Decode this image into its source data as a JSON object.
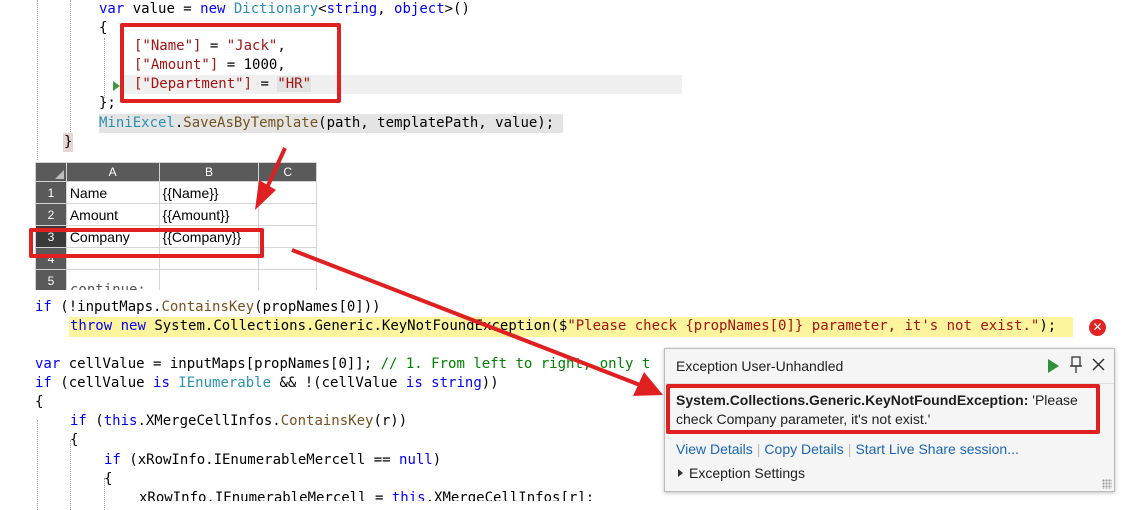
{
  "code_top": {
    "line1": {
      "kw1": "var",
      "txt1": " value = ",
      "kw2": "new",
      "ty": " Dictionary",
      "txt2": "<",
      "kw3": "string",
      "txt3": ", ",
      "kw4": "object",
      "txt4": ">()"
    },
    "brace_open": "{",
    "row_name": {
      "k": "[\"Name\"]",
      "eq": " = ",
      "v": "\"Jack\"",
      "end": ","
    },
    "row_amount": {
      "k": "[\"Amount\"]",
      "eq": " = 1000,"
    },
    "row_dept": {
      "k": "[\"Department\"]",
      "eq": " = ",
      "v": "\"HR\""
    },
    "brace_close": "};",
    "save": {
      "cls": "MiniExcel",
      "dot": ".",
      "m": "SaveAsByTemplate",
      "args": "(path, templatePath, value);"
    },
    "end_brace": "}"
  },
  "sheet": {
    "columns": [
      "A",
      "B",
      "C"
    ],
    "rows": [
      {
        "num": "1",
        "a": "Name",
        "b": "{{Name}}"
      },
      {
        "num": "2",
        "a": "Amount",
        "b": "{{Amount}}"
      },
      {
        "num": "3",
        "a": "Company",
        "b": "{{Company}}"
      },
      {
        "num": "4",
        "a": "",
        "b": ""
      },
      {
        "num": "5",
        "a": "",
        "b": ""
      }
    ]
  },
  "code_bottom": {
    "partial_top": "continue;",
    "if1": {
      "kw": "if",
      "a": " (!inputMaps.",
      "m": "ContainsKey",
      "b": "(propNames[0]))"
    },
    "throw": {
      "kw1": "throw",
      "sp": " ",
      "kw2": "new",
      "t": " System.Collections.Generic.KeyNotFoundException($",
      "s": "\"Please check {propNames[0]} parameter, it's not exist.\"",
      "e": ");"
    },
    "var_line": {
      "kw": "var",
      "a": " cellValue = inputMaps[propNames[0]]; ",
      "c": "// 1. From left to right, only t"
    },
    "if2": {
      "kw": "if",
      "a": " (cellValue ",
      "kw2": "is",
      "t": " IEnumerable",
      "b": " && !(cellValue ",
      "kw3": "is",
      "kw4": " string",
      "e": "))"
    },
    "brace": "{",
    "if3": {
      "kw": "if",
      "a": " (",
      "kw2": "this",
      "b": ".XMergeCellInfos.",
      "m": "ContainsKey",
      "e": "(r))"
    },
    "brace2": "{",
    "if4": {
      "kw": "if",
      "a": " (xRowInfo.IEnumerableMercell == ",
      "kw2": "null",
      "e": ")"
    },
    "brace3": "{",
    "last": {
      "a": "xRowInfo.IEnumerableMercell = ",
      "kw": "this",
      "b": ".XMergeCellInfos[r];"
    }
  },
  "popup": {
    "title": "Exception User-Unhandled",
    "exception_type": "System.Collections.Generic.KeyNotFoundException:",
    "exception_msg": " 'Please check Company parameter, it's not exist.'",
    "link_view": "View Details",
    "link_copy": "Copy Details",
    "link_share": "Start Live Share session...",
    "settings": "Exception Settings",
    "icons": [
      "play-icon",
      "pin-icon",
      "close-icon"
    ]
  },
  "colors": {
    "keyword": "#0000ff",
    "string": "#a31515",
    "type": "#2b91af",
    "method": "#74531f",
    "comment": "#008000",
    "annotation_red": "#e02020",
    "highlight_yellow": "#fdf59d"
  }
}
